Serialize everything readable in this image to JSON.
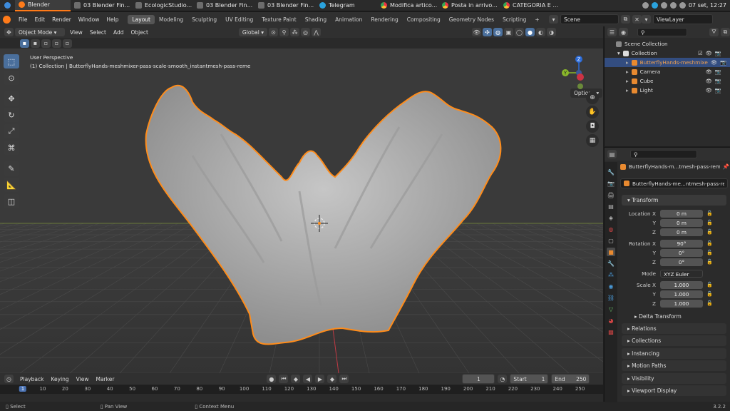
{
  "taskbar": {
    "tabs": [
      {
        "label": "Blender",
        "icon": "blender-icon",
        "active": true
      },
      {
        "label": "03 Blender Fin...",
        "icon": "folder-icon"
      },
      {
        "label": "EcologicStudio...",
        "icon": "folder-icon"
      },
      {
        "label": "03 Blender Fin...",
        "icon": "folder-icon"
      },
      {
        "label": "03 Blender Fin...",
        "icon": "folder-icon"
      },
      {
        "label": "Telegram",
        "icon": "telegram-icon"
      },
      {
        "label": "Modifica artico...",
        "icon": "chrome-icon"
      },
      {
        "label": "Posta in arrivo...",
        "icon": "chrome-icon"
      },
      {
        "label": "CATEGORIA E ...",
        "icon": "chrome-icon"
      }
    ],
    "clock": "07 set, 12:27"
  },
  "topbar": {
    "menus": [
      "File",
      "Edit",
      "Render",
      "Window",
      "Help"
    ],
    "workspaces": [
      "Layout",
      "Modeling",
      "Sculpting",
      "UV Editing",
      "Texture Paint",
      "Shading",
      "Animation",
      "Rendering",
      "Compositing",
      "Geometry Nodes",
      "Scripting"
    ],
    "active_workspace": "Layout",
    "add_tab": "+",
    "scene": "Scene",
    "view_layer": "ViewLayer"
  },
  "viewport_header": {
    "mode": "Object Mode",
    "menus": [
      "View",
      "Select",
      "Add",
      "Object"
    ],
    "transform": "Global",
    "options": "Options"
  },
  "viewport": {
    "perspective": "User Perspective",
    "object_info": "(1) Collection | ButterflyHands-meshmixer-pass-scale-smooth_instantmesh-pass-reme",
    "gizmo": {
      "z": "Z",
      "y": "Y"
    },
    "colors": {
      "accent": "#ff8c1a",
      "selection": "#4a72b3",
      "x_axis": "#cc3344",
      "y_axis": "#8ab82a",
      "z_axis": "#2b6bd8"
    }
  },
  "timeline": {
    "menus": [
      "Playback",
      "Keying",
      "View",
      "Marker"
    ],
    "current_frame": "1",
    "start_label": "Start",
    "start": "1",
    "end_label": "End",
    "end": "250",
    "ruler": [
      "1",
      "10",
      "20",
      "30",
      "40",
      "50",
      "60",
      "70",
      "80",
      "90",
      "100",
      "110",
      "120",
      "130",
      "140",
      "150",
      "160",
      "170",
      "180",
      "190",
      "200",
      "210",
      "220",
      "230",
      "240",
      "250"
    ]
  },
  "statusbar": {
    "select": "Select",
    "pan": "Pan View",
    "context": "Context Menu",
    "version": "3.2.2"
  },
  "outliner": {
    "root": "Scene Collection",
    "collection": "Collection",
    "items": [
      {
        "label": "ButterflyHands-meshmixe",
        "selected": true
      },
      {
        "label": "Camera"
      },
      {
        "label": "Cube"
      },
      {
        "label": "Light"
      }
    ]
  },
  "properties": {
    "object_name": "ButterflyHands-m...tmesh-pass-rem",
    "data_name": "ButterflyHands-me...ntmesh-pass-reme",
    "transform_title": "Transform",
    "location": {
      "label": "Location X",
      "x": "0 m",
      "y": "0 m",
      "z": "0 m"
    },
    "rotation": {
      "label": "Rotation X",
      "x": "90°",
      "y": "0°",
      "z": "0°"
    },
    "mode_label": "Mode",
    "mode": "XYZ Euler",
    "scale": {
      "label": "Scale X",
      "x": "1.000",
      "y": "1.000",
      "z": "1.000"
    },
    "axis_y": "Y",
    "axis_z": "Z",
    "delta": "Delta Transform",
    "panels": [
      "Relations",
      "Collections",
      "Instancing",
      "Motion Paths",
      "Visibility",
      "Viewport Display"
    ]
  }
}
